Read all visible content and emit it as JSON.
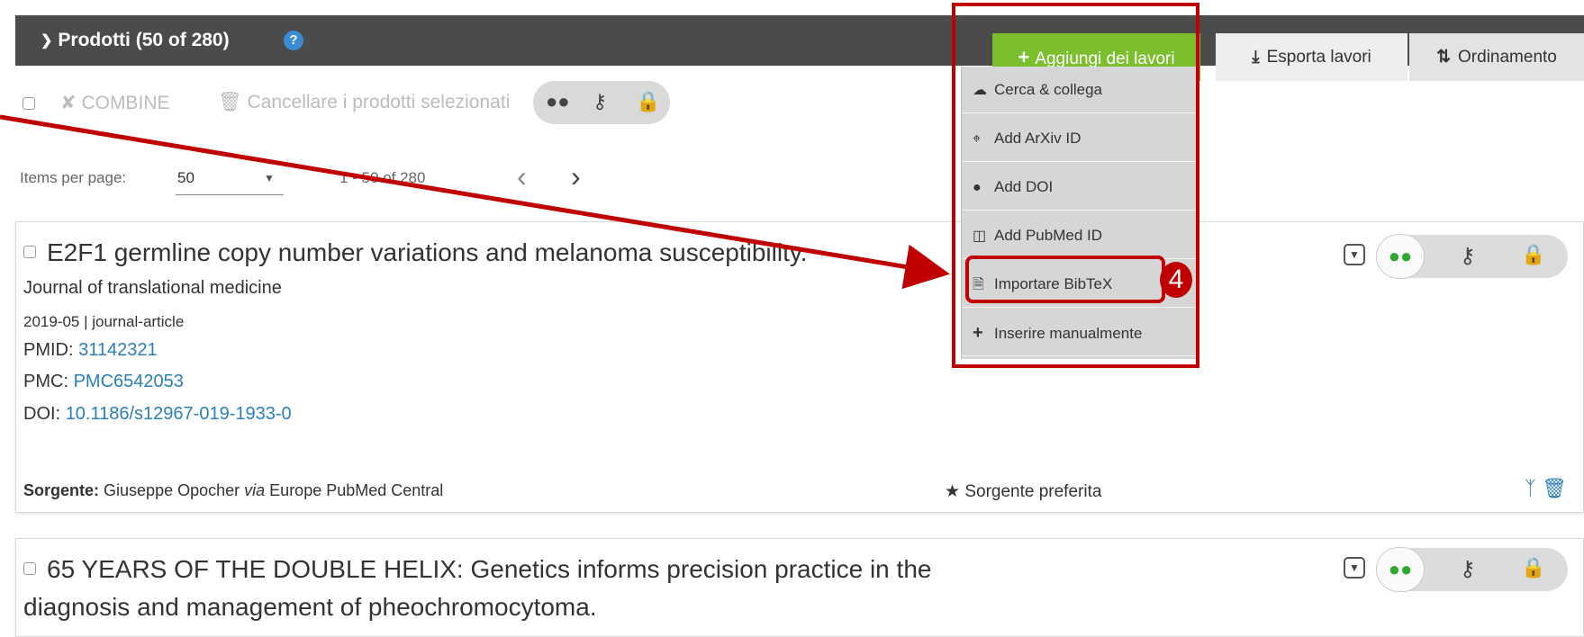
{
  "header": {
    "title": "Prodotti (50 of 280)",
    "help_icon": "?",
    "add_button": "Aggiungi dei lavori",
    "export_button": "Esporta lavori",
    "sort_button": "Ordinamento"
  },
  "toolbar": {
    "combine": "COMBINE",
    "delete_selected": "Cancellare i prodotti selezionati"
  },
  "pagination": {
    "items_per_page_label": "Items per page:",
    "items_per_page_value": "50",
    "range": "1 - 50 of 280"
  },
  "dropdown": {
    "items": [
      {
        "label": "Cerca & collega",
        "icon": "cloud-link-icon"
      },
      {
        "label": "Add ArXiv ID",
        "icon": "arxiv-icon"
      },
      {
        "label": "Add DOI",
        "icon": "doi-icon"
      },
      {
        "label": "Add PubMed ID",
        "icon": "pubmed-icon"
      },
      {
        "label": "Importare BibTeX",
        "icon": "file-import-icon"
      },
      {
        "label": "Inserire manualmente",
        "icon": "plus-icon"
      }
    ]
  },
  "annotation": {
    "step_number": "4",
    "color": "#c00000"
  },
  "works": [
    {
      "title": "E2F1 germline copy number variations and melanoma susceptibility.",
      "journal": "Journal of translational medicine",
      "meta": "2019-05 | journal-article",
      "pmid_label": "PMID:",
      "pmid": "31142321",
      "pmc_label": "PMC:",
      "pmc": "PMC6542053",
      "doi_label": "DOI:",
      "doi": "10.1186/s12967-019-1933-0",
      "source_label": "Sorgente:",
      "source_name": "Giuseppe Opocher",
      "source_via": "via",
      "source_db": "Europe PubMed Central",
      "preferred": "Sorgente preferita"
    },
    {
      "title_line1": "65 YEARS OF THE DOUBLE HELIX: Genetics informs precision practice in the",
      "title_line2": "diagnosis and management of pheochromocytoma."
    }
  ],
  "colors": {
    "header_bg": "#4b4b4b",
    "add_button": "#7cbf2e",
    "link": "#2a7fb8",
    "highlight": "#c00000"
  }
}
